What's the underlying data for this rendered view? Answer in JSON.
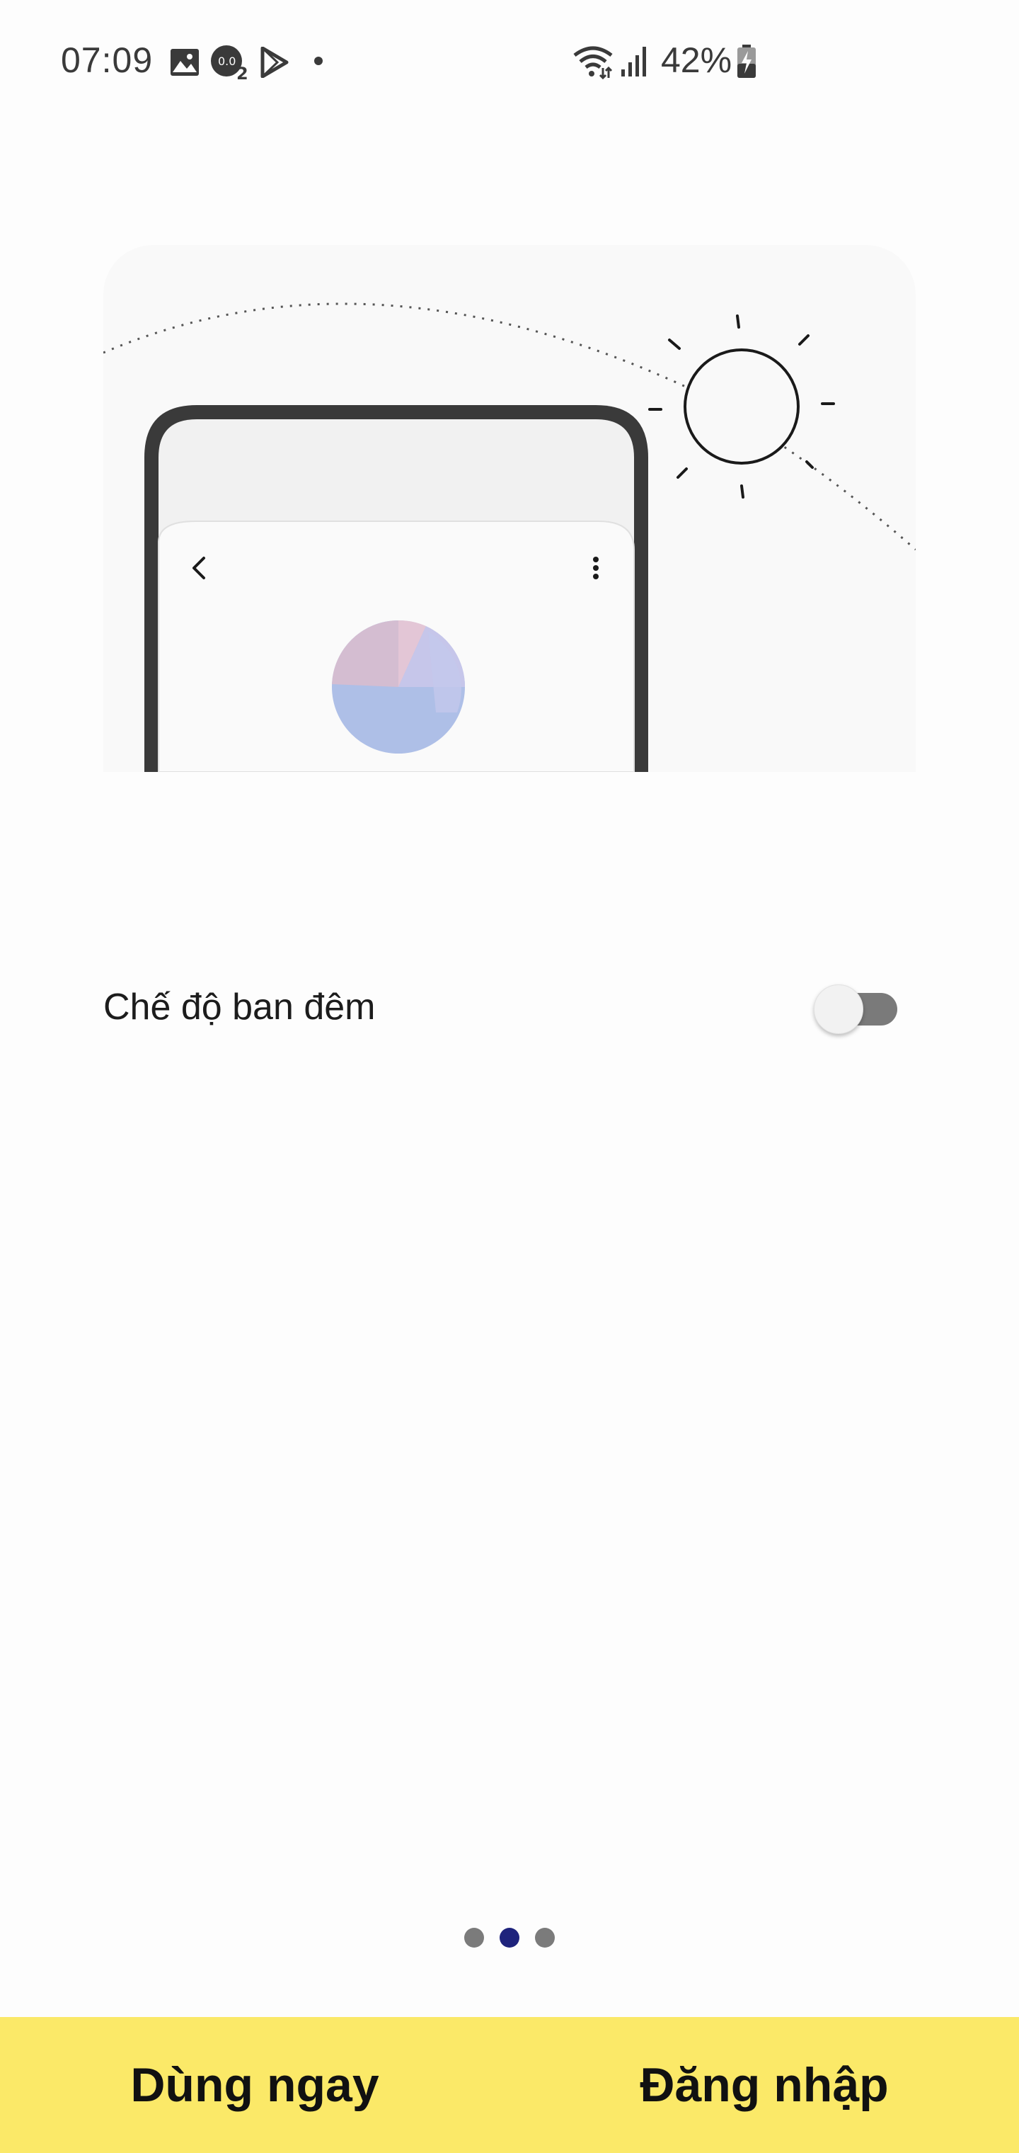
{
  "status_bar": {
    "time": "07:09",
    "battery_percent": "42%",
    "icons": [
      "gallery-icon",
      "notification-badge-icon",
      "play-store-icon",
      "dot-icon",
      "wifi-icon",
      "signal-icon",
      "battery-charging-icon"
    ]
  },
  "illustration": {
    "theme": "day",
    "icons": [
      "sun-icon",
      "back-arrow-icon",
      "more-vert-icon",
      "pie-chart-icon"
    ]
  },
  "setting": {
    "label": "Chế độ ban đêm",
    "enabled": false
  },
  "pager": {
    "total": 3,
    "current": 2
  },
  "bottom_bar": {
    "start_label": "Dùng ngay",
    "login_label": "Đăng nhập",
    "background_color": "#fbe968"
  },
  "colors": {
    "pager_active": "#1e237c",
    "pager_inactive": "#7b7b7b",
    "toggle_track": "#7a7a7a"
  }
}
